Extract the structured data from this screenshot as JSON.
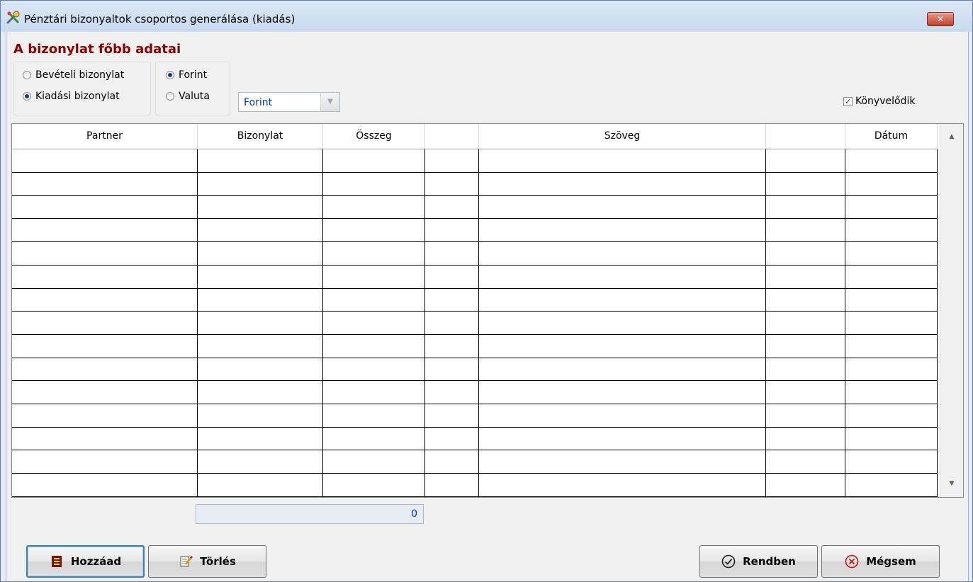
{
  "window": {
    "title": "Pénztári bizonyaltok csoportos generálása (kiadás)",
    "close_glyph": "✕"
  },
  "section": {
    "title": "A bizonylat főbb adatai"
  },
  "doc_type": {
    "options": [
      {
        "label": "Bevételi bizonylat",
        "checked": false
      },
      {
        "label": "Kiadási bizonylat",
        "checked": true
      }
    ]
  },
  "currency_type": {
    "options": [
      {
        "label": "Forint",
        "checked": true
      },
      {
        "label": "Valuta",
        "checked": false
      }
    ]
  },
  "currency_select": {
    "value": "Forint",
    "arrow": "▼"
  },
  "posting": {
    "label": "Könyvelődik",
    "checked": true,
    "check_glyph": "✓"
  },
  "grid": {
    "columns": [
      "Partner",
      "Bizonylat",
      "Összeg",
      "",
      "Szöveg",
      "",
      "Dátum"
    ],
    "row_count": 15,
    "scroll_up": "▲",
    "scroll_down": "▼"
  },
  "total": {
    "value": "0"
  },
  "buttons": {
    "add": "Hozzáad",
    "delete": "Törlés",
    "ok": "Rendben",
    "cancel": "Mégsem"
  },
  "colors": {
    "section_title": "#8b0000",
    "value_blue": "#0033cc",
    "close_red": "#c2412c"
  },
  "icons": {
    "app": "tools-icon",
    "add": "add-document-icon",
    "delete": "delete-document-icon",
    "ok": "check-circle-icon",
    "cancel": "cancel-circle-icon"
  }
}
